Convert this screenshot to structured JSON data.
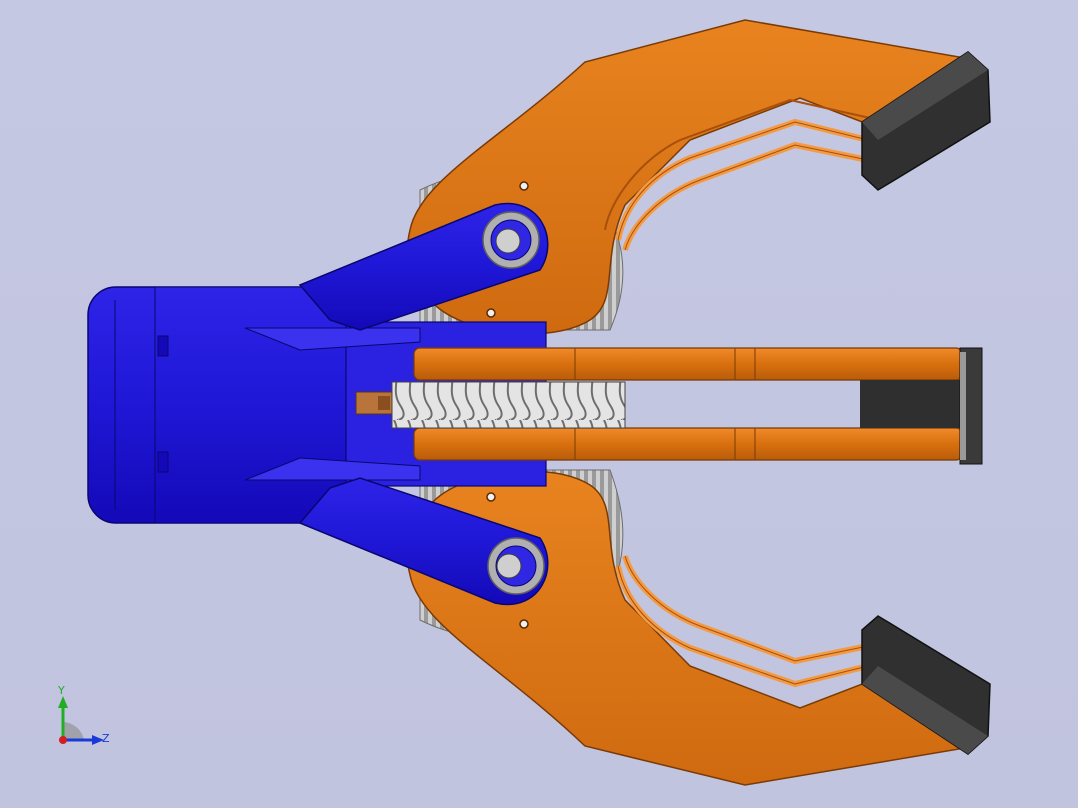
{
  "viewport": {
    "background": "#c3c6e0"
  },
  "model": {
    "parts": [
      "gripper-base",
      "worm-gear",
      "jaw-upper",
      "jaw-lower",
      "link-upper",
      "link-lower",
      "slide-rails",
      "finger-pad-upper",
      "finger-pad-lower",
      "spur-gear-upper",
      "spur-gear-lower"
    ],
    "colors": {
      "jaw": "#e07316",
      "jaw_dark": "#a84f0c",
      "base": "#1f17d6",
      "base_dark": "#0e0a8a",
      "gear": "#d5d5d5",
      "pad": "#2f2f2f"
    }
  },
  "triad": {
    "y_label": "Y",
    "z_label": "Z",
    "y_color": "#1fae24",
    "z_color": "#1a3ad8",
    "x_color": "#d21e1e"
  }
}
